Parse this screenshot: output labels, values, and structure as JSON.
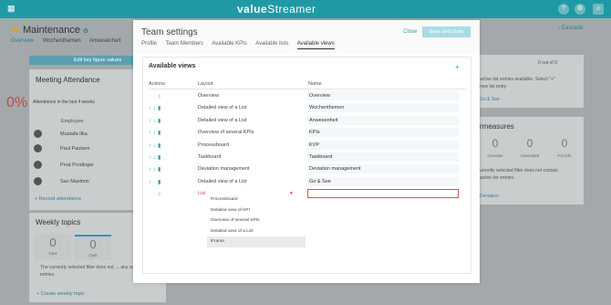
{
  "app": {
    "brand_part1": "value",
    "brand_part2": "Streamer"
  },
  "topbar": {
    "grid_icon": "grid-icon",
    "help_icon": "help-icon",
    "settings_icon": "settings-icon",
    "user_icon": "user-icon"
  },
  "page": {
    "title": "Maintenance",
    "tabs": [
      "Overview",
      "Wochenthemen",
      "Anwesenheit"
    ],
    "cascade_link": "Cascade"
  },
  "background": {
    "kpi_button": "Edit key figure values",
    "meeting": {
      "title": "Meeting Attendance",
      "percent": "0%",
      "subtitle": "Attendance in the last 4 weeks",
      "employee_header": "Employee",
      "employees": [
        "Mustafa Ilka",
        "Paul Paulsen",
        "Prod Prodinger",
        "San Maximin"
      ],
      "record_link": "Record attendance"
    },
    "weekly": {
      "title": "Weekly topics",
      "boxes": [
        {
          "num": "0",
          "label": "Cw4"
        },
        {
          "num": "0",
          "label": "Cw5"
        }
      ],
      "note": "The currently selected filter does not … any active list entries.",
      "create_link": "Create weekly topic"
    },
    "right_top": {
      "pager": "0 out of 0",
      "text": "active list entries available. Select \"+\"",
      "text2": "new list entry",
      "link": "Go & See"
    },
    "right_measures": {
      "title": "rmeasures",
      "kpis": [
        {
          "num": "0",
          "label": "Overdue"
        },
        {
          "num": "0",
          "label": "Cascaded"
        },
        {
          "num": "0",
          "label": "For info"
        }
      ],
      "text": "urrently selected filter does not contain",
      "text2": "active list entries.",
      "link": "Deviation"
    }
  },
  "modal": {
    "title": "Team settings",
    "close_label": "Close",
    "save_label": "Save and close",
    "tabs": [
      "Profile",
      "Team Members",
      "Available KPIs",
      "Available lists",
      "Available views"
    ],
    "panel_title": "Available views",
    "col_actions": "Actions",
    "col_layout": "Layout",
    "col_name": "Name",
    "rows": [
      {
        "layout": "Overview",
        "name": "Overview"
      },
      {
        "layout": "Detailed view of a List",
        "name": "Wochenthemen"
      },
      {
        "layout": "Detailed view of a List",
        "name": "Anwesenheit"
      },
      {
        "layout": "Overview of several KPIs",
        "name": "KPIs"
      },
      {
        "layout": "Processboard",
        "name": "KVP"
      },
      {
        "layout": "Taskboard",
        "name": "Taskboard"
      },
      {
        "layout": "Deviation management",
        "name": "Deviation management"
      },
      {
        "layout": "Detailed view of a List",
        "name": "Go & See"
      },
      {
        "layout": "List",
        "name": ""
      }
    ],
    "dropdown_options": [
      "Processboard",
      "Detailed view of KPI",
      "Overview of several KPIs",
      "Detailed view of a List",
      "iFrame"
    ],
    "dropdown_selected": "iFrame"
  }
}
